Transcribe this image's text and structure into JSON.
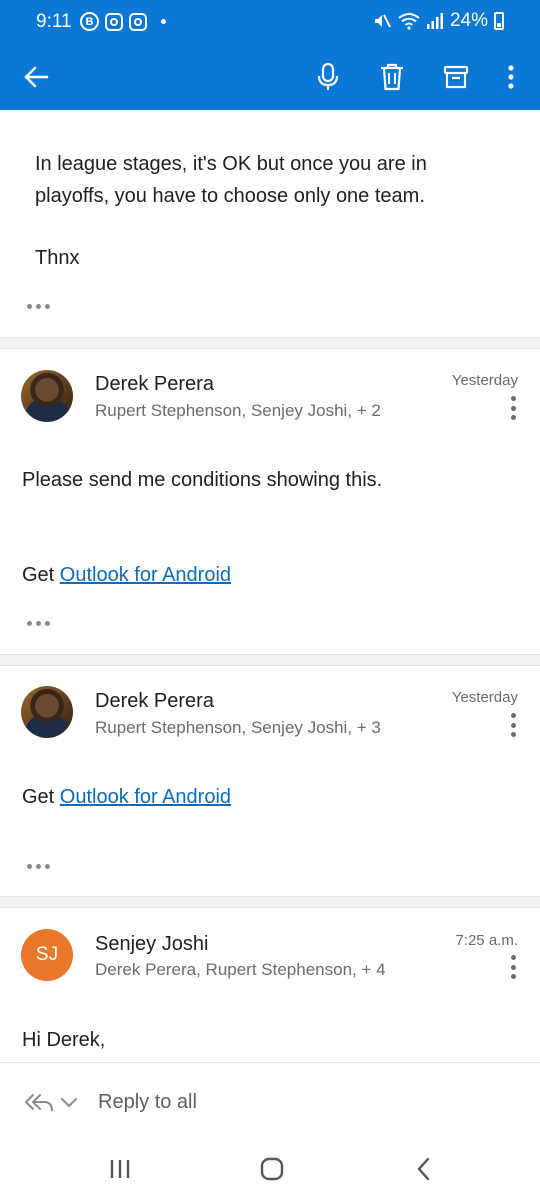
{
  "status_bar": {
    "time": "9:11",
    "notif_icons": [
      "b-circle-icon",
      "instagram-icon",
      "instagram-icon"
    ],
    "battery": "24%"
  },
  "toolbar": {
    "actions": [
      "back-icon",
      "microphone-icon",
      "delete-icon",
      "archive-icon",
      "more-icon"
    ]
  },
  "messages": [
    {
      "body": [
        "In league stages, it's OK but once you are in playoffs, you have to choose only one team.",
        "Thnx"
      ]
    },
    {
      "sender": "Derek Perera",
      "recipients": "Rupert Stephenson, Senjey Joshi, + 2",
      "date": "Yesterday",
      "body": "Please send me conditions showing this.",
      "signature_prefix": "Get ",
      "signature_link": "Outlook for Android"
    },
    {
      "sender": "Derek Perera",
      "recipients": "Rupert Stephenson, Senjey Joshi, + 3",
      "date": "Yesterday",
      "signature_prefix": "Get ",
      "signature_link": "Outlook for Android"
    },
    {
      "sender": "Senjey Joshi",
      "initials": "SJ",
      "avatar_color": "#e8792b",
      "recipients": "Derek Perera, Rupert Stephenson, + 4",
      "date": "7:25 a.m.",
      "body": "Hi Derek,"
    }
  ],
  "reply_bar": {
    "label": "Reply to all"
  },
  "colors": {
    "accent": "#0a78d4",
    "link": "#0a6cbd"
  }
}
